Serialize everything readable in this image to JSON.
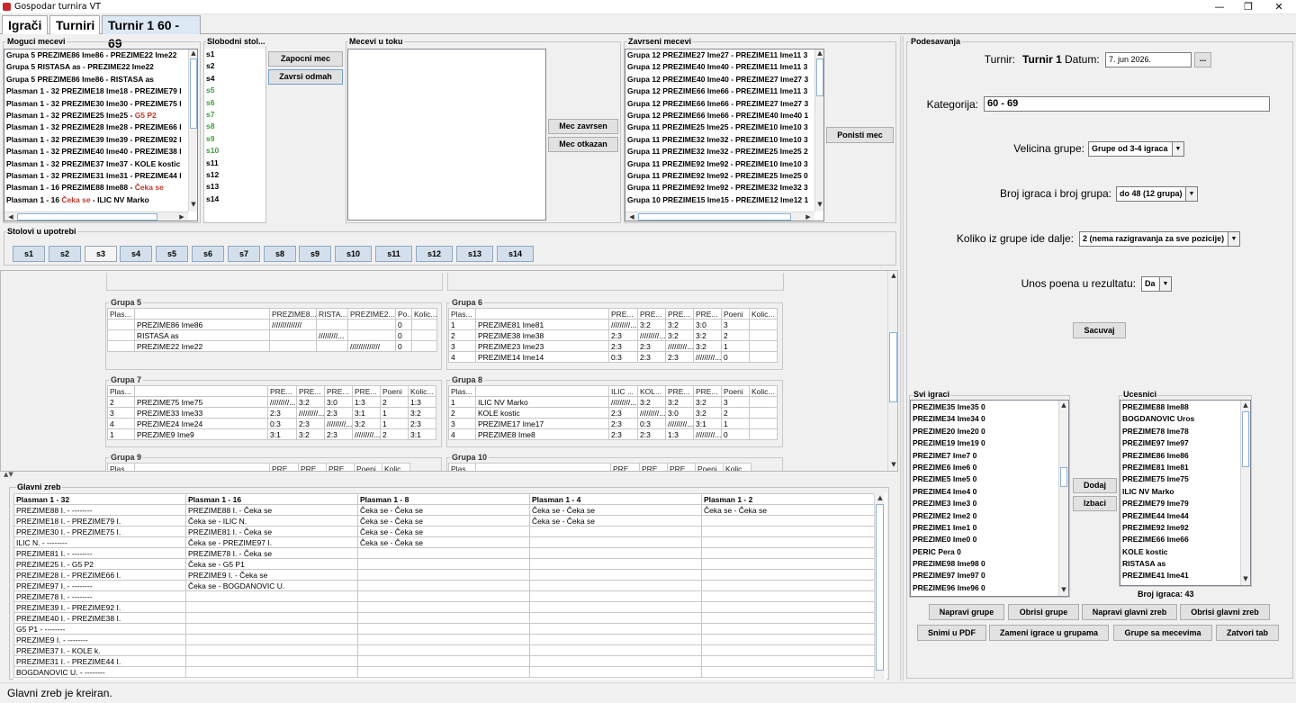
{
  "window": {
    "title": "Gospodar turnira VT",
    "min": "—",
    "max": "❐",
    "close": "✕"
  },
  "tabs": [
    "Igrači",
    "Turniri",
    "Turnir 1 60 - 69"
  ],
  "moguci": {
    "title": "Moguci mecevi",
    "items": [
      [
        {
          "t": "Grupa 5 PREZIME86 Ime86 - PREZIME22 Ime22"
        }
      ],
      [
        {
          "t": "Grupa 5 RISTASA as - PREZIME22 Ime22"
        }
      ],
      [
        {
          "t": "Grupa 5 PREZIME86 Ime86 - RISTASA as"
        }
      ],
      [
        {
          "t": "Plasman 1 - 32 PREZIME18 Ime18 - PREZIME79 I"
        }
      ],
      [
        {
          "t": "Plasman 1 - 32 PREZIME30 Ime30 - PREZIME75 I"
        }
      ],
      [
        {
          "t": "Plasman 1 - 32 PREZIME25 Ime25 - "
        },
        {
          "t": "G5 P2",
          "c": "red"
        }
      ],
      [
        {
          "t": "Plasman 1 - 32 PREZIME28 Ime28 - PREZIME66 I"
        }
      ],
      [
        {
          "t": "Plasman 1 - 32 PREZIME39 Ime39 - PREZIME92 I"
        }
      ],
      [
        {
          "t": "Plasman 1 - 32 PREZIME40 Ime40 - PREZIME38 I"
        }
      ],
      [
        {
          "t": "Plasman 1 - 32 PREZIME37 Ime37 - KOLE kostic"
        }
      ],
      [
        {
          "t": "Plasman 1 - 32 PREZIME31 Ime31 - PREZIME44 I"
        }
      ],
      [
        {
          "t": "Plasman 1 - 16 PREZIME88 Ime88 - "
        },
        {
          "t": "Čeka se",
          "c": "red"
        }
      ],
      [
        {
          "t": "Plasman 1 - 16 "
        },
        {
          "t": "Čeka se",
          "c": "red"
        },
        {
          "t": " - ILIC NV Marko"
        }
      ]
    ]
  },
  "slobodni": {
    "title": "Slobodni stol...",
    "items": [
      {
        "t": "s1",
        "c": ""
      },
      {
        "t": "s2",
        "c": ""
      },
      {
        "t": "s4",
        "c": ""
      },
      {
        "t": "s5",
        "c": "green"
      },
      {
        "t": "s6",
        "c": "green"
      },
      {
        "t": "s7",
        "c": "green"
      },
      {
        "t": "s8",
        "c": "green"
      },
      {
        "t": "s9",
        "c": "green"
      },
      {
        "t": "s10",
        "c": "green"
      },
      {
        "t": "s11",
        "c": ""
      },
      {
        "t": "s12",
        "c": ""
      },
      {
        "t": "s13",
        "c": ""
      },
      {
        "t": "s14",
        "c": ""
      }
    ]
  },
  "buttons": {
    "zapocni": "Zapocni mec",
    "zavrsi": "Zavrsi odmah",
    "mec_zavrsen": "Mec zavrsen",
    "mec_otkazan": "Mec otkazan",
    "ponisti": "Ponisti mec"
  },
  "u_toku": {
    "title": "Mecevi u toku"
  },
  "zavrseni": {
    "title": "Zavrseni mecevi",
    "items": [
      "Grupa 12 PREZIME27 Ime27 - PREZIME11 Ime11 3",
      "Grupa 12 PREZIME40 Ime40 - PREZIME11 Ime11 3",
      "Grupa 12 PREZIME40 Ime40 - PREZIME27 Ime27 3",
      "Grupa 12 PREZIME66 Ime66 - PREZIME11 Ime11 3",
      "Grupa 12 PREZIME66 Ime66 - PREZIME27 Ime27 3",
      "Grupa 12 PREZIME66 Ime66 - PREZIME40 Ime40 1",
      "Grupa 11 PREZIME25 Ime25 - PREZIME10 Ime10 3",
      "Grupa 11 PREZIME32 Ime32 - PREZIME10 Ime10 3",
      "Grupa 11 PREZIME32 Ime32 - PREZIME25 Ime25 2",
      "Grupa 11 PREZIME92 Ime92 - PREZIME10 Ime10 3",
      "Grupa 11 PREZIME92 Ime92 - PREZIME25 Ime25 0",
      "Grupa 11 PREZIME92 Ime92 - PREZIME32 Ime32 3",
      "Grupa 10 PREZIME15 Ime15 - PREZIME12 Ime12 1"
    ]
  },
  "stolovi": {
    "title": "Stolovi u upotrebi",
    "items": [
      "s1",
      "s2",
      "s3",
      "s4",
      "s5",
      "s6",
      "s7",
      "s8",
      "s9",
      "s10",
      "s11",
      "s12",
      "s13",
      "s14"
    ]
  },
  "groups": [
    {
      "name": "Grupa 5",
      "headers": [
        "Plas...",
        "",
        "PREZIME8...",
        "RISTA...",
        "PREZIME2...",
        "Po...",
        "Kolic..."
      ],
      "rows": [
        [
          "",
          "PREZIME86 Ime86",
          "//////////////",
          "",
          "",
          "0",
          ""
        ],
        [
          "",
          "RISTASA as",
          "",
          "/////////...",
          "",
          "0",
          ""
        ],
        [
          "",
          "PREZIME22 Ime22",
          "",
          "",
          "//////////////",
          "0",
          ""
        ]
      ]
    },
    {
      "name": "Grupa 6",
      "headers": [
        "Plas...",
        "",
        "PRE...",
        "PRE...",
        "PRE...",
        "PRE...",
        "Poeni",
        "Kolic..."
      ],
      "rows": [
        [
          "1",
          "PREZIME81 Ime81",
          "/////////...",
          "3:2",
          "3:2",
          "3:0",
          "3",
          ""
        ],
        [
          "2",
          "PREZIME38 Ime38",
          "2:3",
          "/////////...",
          "3:2",
          "3:2",
          "2",
          ""
        ],
        [
          "3",
          "PREZIME23 Ime23",
          "2:3",
          "2:3",
          "/////////...",
          "3:2",
          "1",
          ""
        ],
        [
          "4",
          "PREZIME14 Ime14",
          "0:3",
          "2:3",
          "2:3",
          "/////////...",
          "0",
          ""
        ]
      ]
    },
    {
      "name": "Grupa 7",
      "headers": [
        "Plas...",
        "",
        "PRE...",
        "PRE...",
        "PRE...",
        "PRE...",
        "Poeni",
        "Kolic..."
      ],
      "rows": [
        [
          "2",
          "PREZIME75 Ime75",
          "/////////...",
          "3:2",
          "3:0",
          "1:3",
          "2",
          "1:3"
        ],
        [
          "3",
          "PREZIME33 Ime33",
          "2:3",
          "/////////...",
          "2:3",
          "3:1",
          "1",
          "3:2"
        ],
        [
          "4",
          "PREZIME24 Ime24",
          "0:3",
          "2:3",
          "/////////...",
          "3:2",
          "1",
          "2:3"
        ],
        [
          "1",
          "PREZIME9 Ime9",
          "3:1",
          "3:2",
          "2:3",
          "/////////...",
          "2",
          "3:1"
        ]
      ]
    },
    {
      "name": "Grupa 8",
      "headers": [
        "Plas...",
        "",
        "ILIC ...",
        "KOL...",
        "PRE...",
        "PRE...",
        "Poeni",
        "Kolic..."
      ],
      "rows": [
        [
          "1",
          "ILIC NV Marko",
          "/////////...",
          "3:2",
          "3:2",
          "3:2",
          "3",
          ""
        ],
        [
          "2",
          "KOLE kostic",
          "2:3",
          "/////////...",
          "3:0",
          "3:2",
          "2",
          ""
        ],
        [
          "3",
          "PREZIME17 Ime17",
          "2:3",
          "0:3",
          "/////////...",
          "3:1",
          "1",
          ""
        ],
        [
          "4",
          "PREZIME8 Ime8",
          "2:3",
          "2:3",
          "1:3",
          "/////////...",
          "0",
          ""
        ]
      ]
    },
    {
      "name": "Grupa 9",
      "headers": [
        "Plas...",
        "",
        "PRE...",
        "PRE...",
        "PRE...",
        "Poeni",
        "Kolic..."
      ],
      "rows": []
    },
    {
      "name": "Grupa 10",
      "headers": [
        "Plas...",
        "",
        "PRE...",
        "PRE...",
        "PRE...",
        "Poeni",
        "Kolic..."
      ],
      "rows": []
    }
  ],
  "glavni": {
    "title": "Glavni zreb",
    "headers": [
      "Plasman 1 - 32",
      "Plasman 1 - 16",
      "Plasman 1 - 8",
      "Plasman 1 - 4",
      "Plasman 1 - 2"
    ],
    "rows": [
      [
        "PREZIME88 I. - --------",
        "PREZIME88 I. - Čeka se",
        "Čeka se - Čeka se",
        "Čeka se - Čeka se",
        "Čeka se - Čeka se"
      ],
      [
        "PREZIME18 I. - PREZIME79 I.",
        "Čeka se - ILIC N.",
        "Čeka se - Čeka se",
        "Čeka se - Čeka se",
        ""
      ],
      [
        "PREZIME30 I. - PREZIME75 I.",
        "PREZIME81 I. - Čeka se",
        "Čeka se - Čeka se",
        "",
        ""
      ],
      [
        "ILIC N. - --------",
        "Čeka se - PREZIME97 I.",
        "Čeka se - Čeka se",
        "",
        ""
      ],
      [
        "PREZIME81 I. - --------",
        "PREZIME78 I. - Čeka se",
        "",
        "",
        ""
      ],
      [
        "PREZIME25 I. - G5 P2",
        "Čeka se - G5 P1",
        "",
        "",
        ""
      ],
      [
        "PREZIME28 I. - PREZIME66 I.",
        "PREZIME9 I. - Čeka se",
        "",
        "",
        ""
      ],
      [
        "PREZIME97 I. - --------",
        "Čeka se - BOGDANOVIC U.",
        "",
        "",
        ""
      ],
      [
        "PREZIME78 I. - --------",
        "",
        "",
        "",
        ""
      ],
      [
        "PREZIME39 I. - PREZIME92 I.",
        "",
        "",
        "",
        ""
      ],
      [
        "PREZIME40 I. - PREZIME38 I.",
        "",
        "",
        "",
        ""
      ],
      [
        "G5 P1 - --------",
        "",
        "",
        "",
        ""
      ],
      [
        "PREZIME9 I. - --------",
        "",
        "",
        "",
        ""
      ],
      [
        "PREZIME37 I. - KOLE k.",
        "",
        "",
        "",
        ""
      ],
      [
        "PREZIME31 I. - PREZIME44 I.",
        "",
        "",
        "",
        ""
      ],
      [
        "BOGDANOVIC U. - --------",
        "",
        "",
        "",
        ""
      ]
    ]
  },
  "settings": {
    "title": "Podesavanja",
    "turnir_label": "Turnir:",
    "turnir_value": "Turnir 1",
    "datum_label": "Datum:",
    "datum_value": "7. jun 2026.",
    "date_btn": "...",
    "kategorija_label": "Kategorija:",
    "kategorija_value": "60 - 69",
    "velicina_label": "Velicina grupe:",
    "velicina_value": "Grupe od 3-4 igraca",
    "broj_label": "Broj igraca i broj grupa:",
    "broj_value": "do 48 (12 grupa)",
    "koliko_label": "Koliko iz grupe ide dalje:",
    "koliko_value": "2 (nema razigravanja za sve pozicije)",
    "unos_label": "Unos poena u rezultatu:",
    "unos_value": "Da",
    "sacuvaj": "Sacuvaj"
  },
  "svi_igraci": {
    "title": "Svi igraci",
    "items": [
      "PREZIME35 Ime35 0",
      "PREZIME34 Ime34 0",
      "PREZIME20 Ime20 0",
      "PREZIME19 Ime19 0",
      "PREZIME7 Ime7 0",
      "PREZIME6 Ime6 0",
      "PREZIME5 Ime5 0",
      "PREZIME4 Ime4 0",
      "PREZIME3 Ime3 0",
      "PREZIME2 Ime2 0",
      "PREZIME1 Ime1 0",
      "PREZIME0 Ime0 0",
      "PERIC Pera 0",
      "PREZIME98 Ime98 0",
      "PREZIME97 Ime97 0",
      "PREZIME96 Ime96 0"
    ]
  },
  "ucesnici": {
    "title": "Ucesnici",
    "items": [
      "PREZIME88 Ime88",
      "BOGDANOVIC Uros",
      "PREZIME78 Ime78",
      "PREZIME97 Ime97",
      "PREZIME86 Ime86",
      "PREZIME81 Ime81",
      "PREZIME75 Ime75",
      "ILIC NV Marko",
      "PREZIME79 Ime79",
      "PREZIME44 Ime44",
      "PREZIME92 Ime92",
      "PREZIME66 Ime66",
      "KOLE kostic",
      "RISTASA as",
      "PREZIME41 Ime41"
    ]
  },
  "dodaj": "Dodaj",
  "izbaci": "Izbaci",
  "broj_igraca": "Broj igraca: 43",
  "bottom_buttons": [
    "Napravi grupe",
    "Obrisi grupe",
    "Napravi glavni zreb",
    "Obrisi glavni zreb",
    "Snimi u PDF",
    "Zameni igrace u grupama",
    "Grupe sa mecevima",
    "Zatvori tab"
  ],
  "status": "Glavni zreb je kreiran."
}
